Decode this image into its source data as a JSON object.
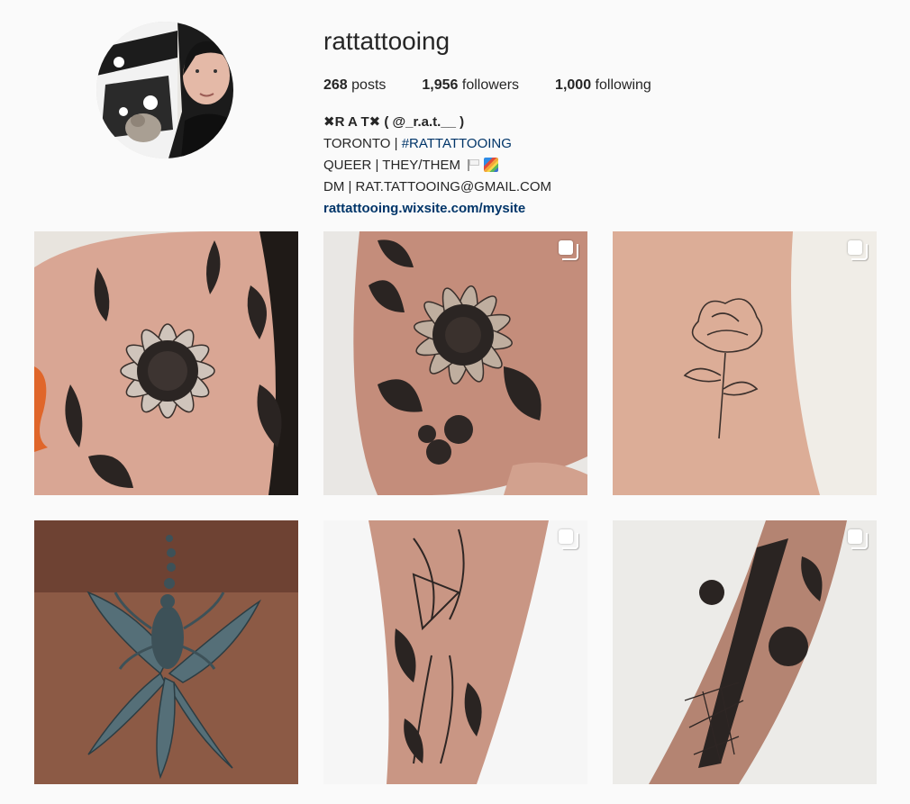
{
  "profile": {
    "username": "rattattooing",
    "stats": {
      "posts_count": "268",
      "posts_label": "posts",
      "followers_count": "1,956",
      "followers_label": "followers",
      "following_count": "1,000",
      "following_label": "following"
    },
    "bio": {
      "name": "✖R A T✖ ( @_r.a.t.__ )",
      "location": "TORONTO | ",
      "hashtag": "#RATTATTOOING",
      "identity": "QUEER | THEY/THEM ",
      "contact": "DM | RAT.TATTOOING@GMAIL.COM",
      "website": "rattattooing.wixsite.com/mysite"
    }
  },
  "posts": [
    {
      "subject": "sunflower and fern hand tattoo",
      "multi": false
    },
    {
      "subject": "sunflower and blackberry foot tattoo",
      "multi": true
    },
    {
      "subject": "fine line peony ankle tattoo",
      "multi": true
    },
    {
      "subject": "scorpion and lily tattoo",
      "multi": false
    },
    {
      "subject": "geometric faces and ferns leg sleeve",
      "multi": true
    },
    {
      "subject": "knife, roses and spiderweb forearm tattoo",
      "multi": true
    }
  ],
  "colors": {
    "text": "#262626",
    "link": "#003569",
    "background": "#fafafa"
  },
  "icons": {
    "multi_post": "stacked-squares-icon"
  }
}
